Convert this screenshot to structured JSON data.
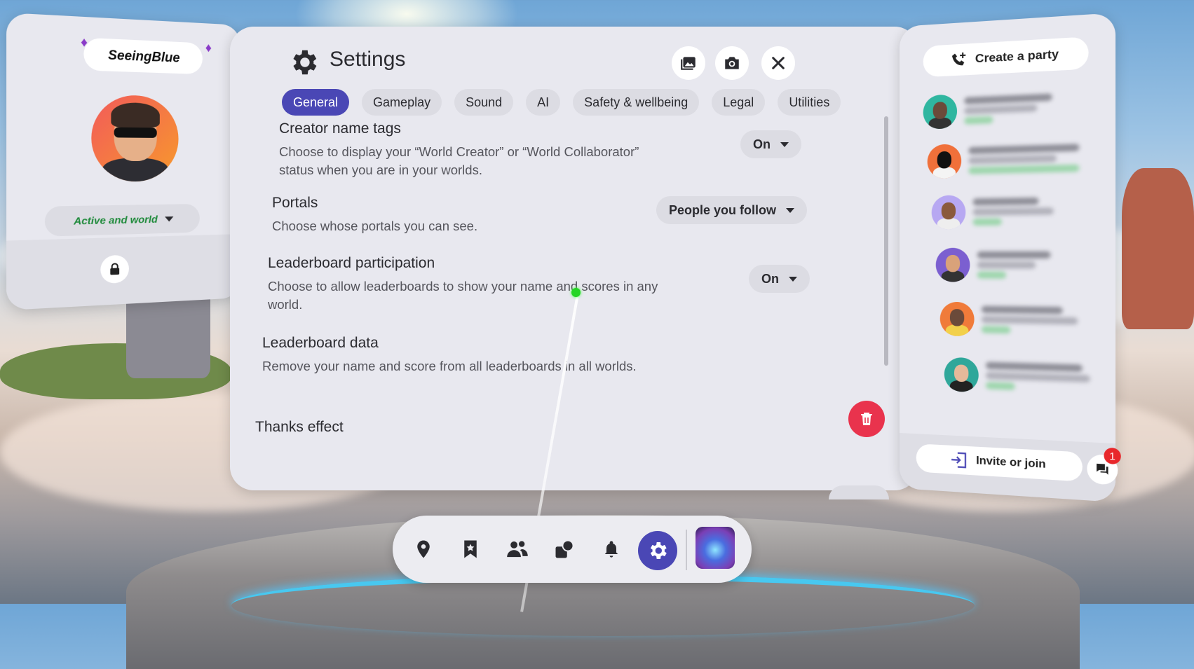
{
  "profile": {
    "username": "SeeingBlue",
    "status": "Active and world"
  },
  "settings": {
    "title": "Settings",
    "tabs": [
      {
        "label": "General",
        "active": true
      },
      {
        "label": "Gameplay",
        "active": false
      },
      {
        "label": "Sound",
        "active": false
      },
      {
        "label": "AI",
        "active": false
      },
      {
        "label": "Safety & wellbeing",
        "active": false
      },
      {
        "label": "Legal",
        "active": false
      },
      {
        "label": "Utilities",
        "active": false
      }
    ],
    "items": [
      {
        "title": "Creator name tags",
        "description": "Choose to display your “World Creator” or “World Collaborator” status when you are in your worlds.",
        "value": "On"
      },
      {
        "title": "Portals",
        "description": "Choose whose portals you can see.",
        "value": "People you follow"
      },
      {
        "title": "Leaderboard participation",
        "description": "Choose to allow leaderboards to show your name and scores in any world.",
        "value": "On"
      },
      {
        "title": "Leaderboard data",
        "description": "Remove your name and score from all leaderboards in all worlds."
      },
      {
        "title": "Thanks effect"
      }
    ]
  },
  "people": {
    "create_party_label": "Create a party",
    "invite_label": "Invite or join",
    "unread_count": "1"
  },
  "colors": {
    "accent": "#4a47b5",
    "danger": "#e9334d",
    "online": "#1f8a3b"
  },
  "icons": {
    "dock": [
      "location-pin-icon",
      "bookmark-star-icon",
      "people-icon",
      "shapes-icon",
      "bell-icon",
      "gear-icon"
    ]
  }
}
